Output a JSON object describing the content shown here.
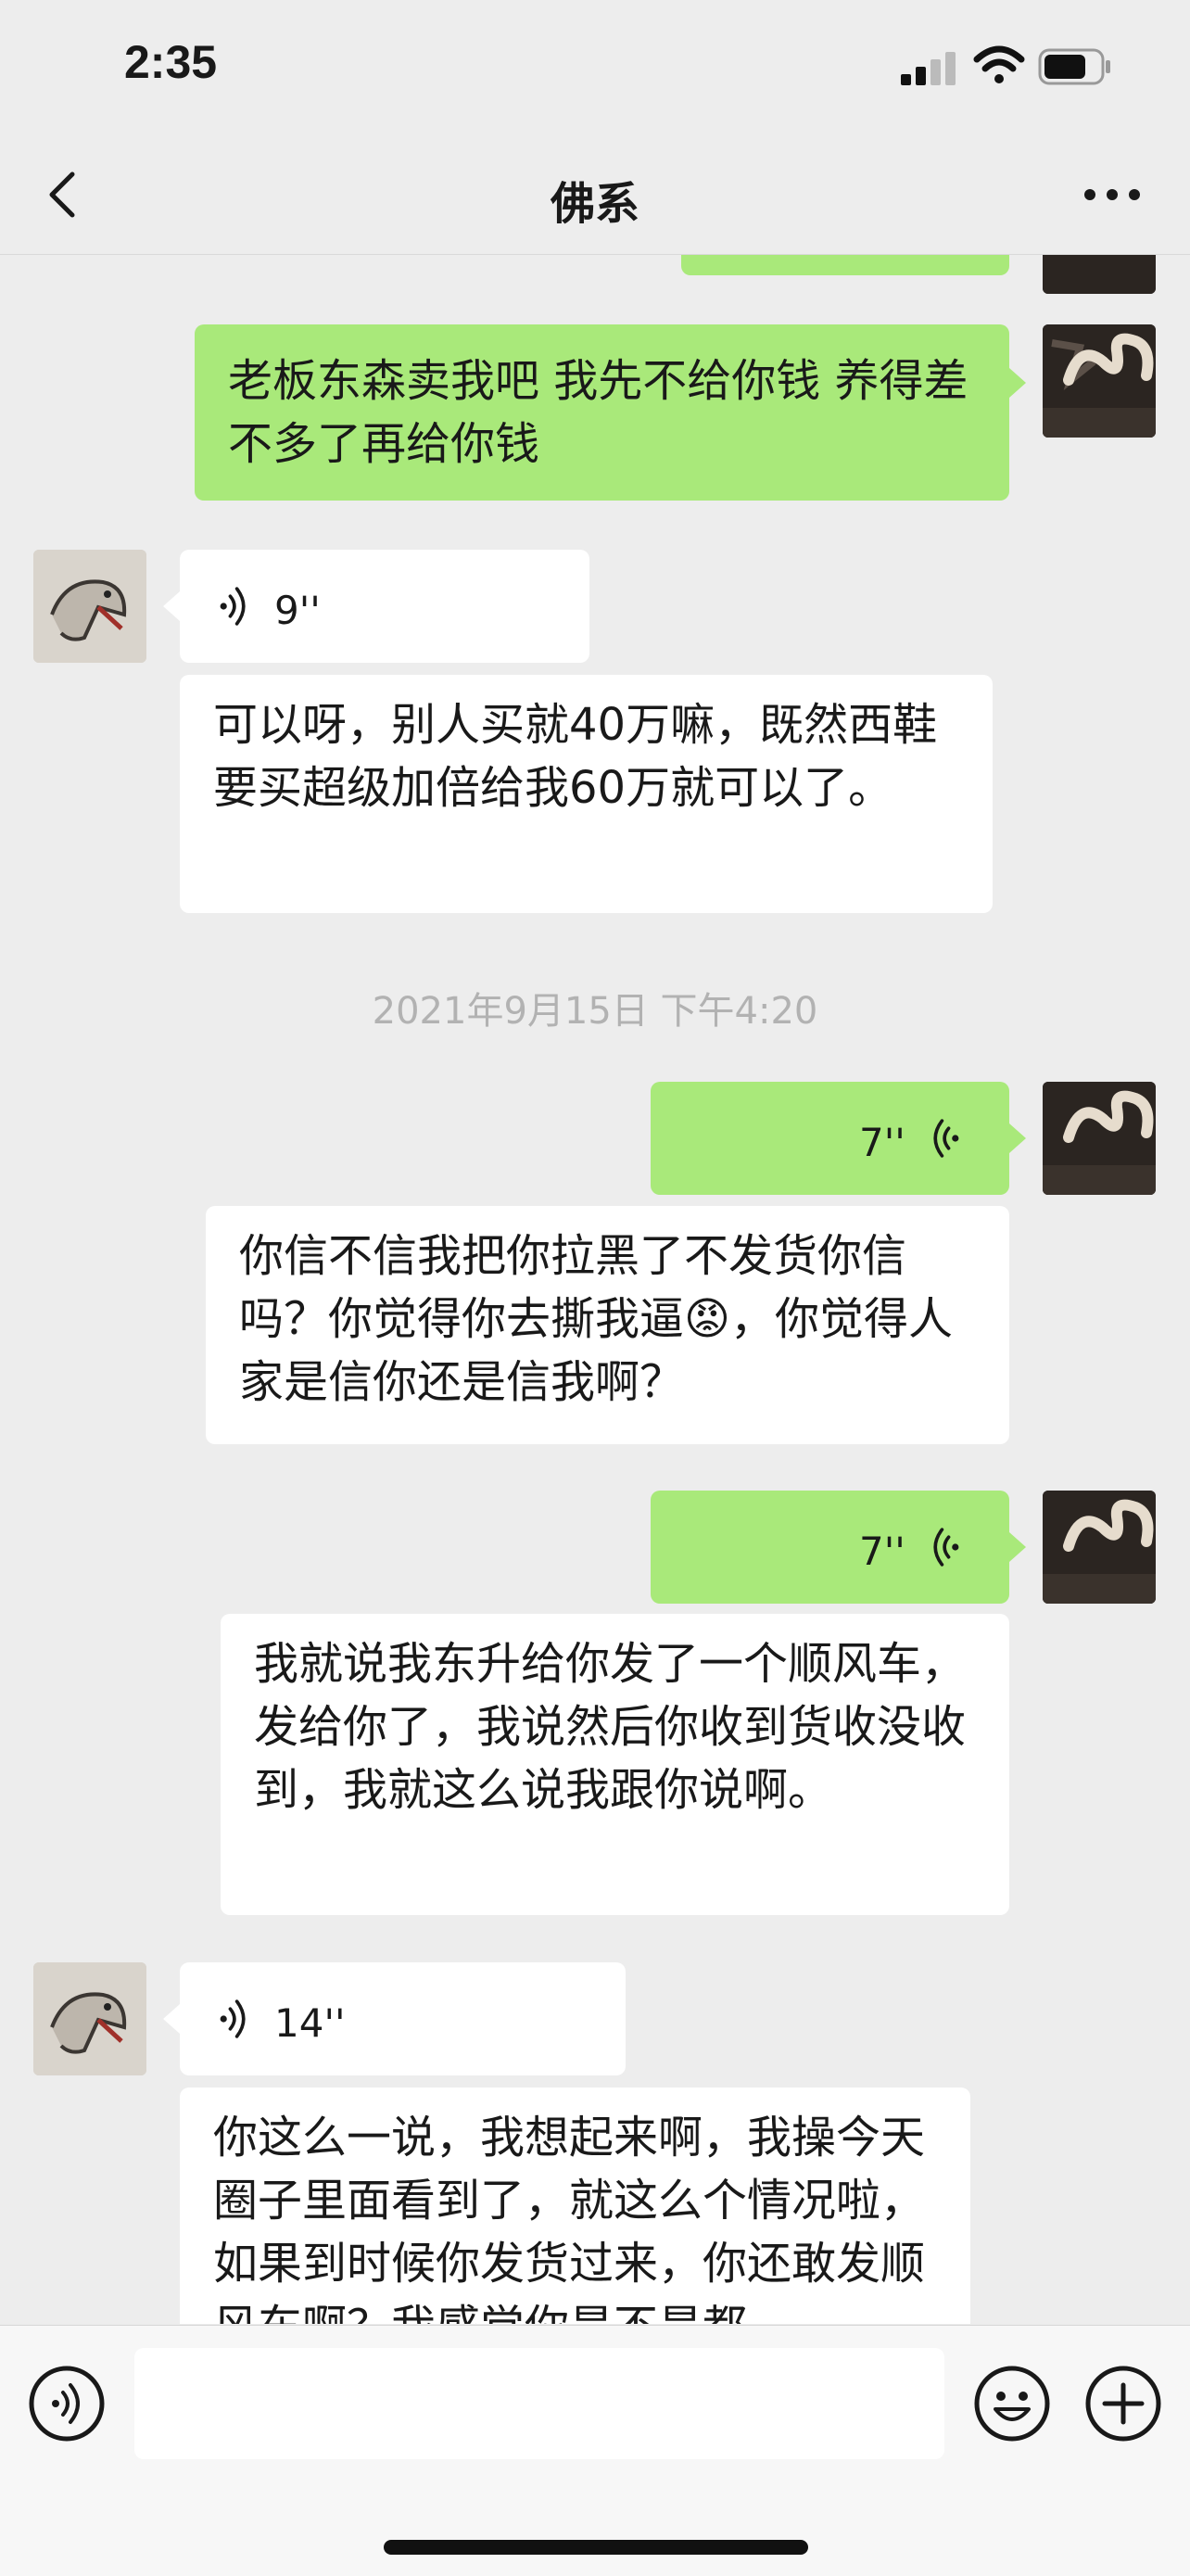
{
  "status_bar": {
    "time": "2:35"
  },
  "header": {
    "title": "佛系"
  },
  "messages": {
    "m1": {
      "text": "老板东森卖我吧 我先不给你钱 养得差不多了再给你钱"
    },
    "m2": {
      "duration": "9''"
    },
    "m3": {
      "text": "可以呀，别人买就40万嘛，既然西鞋要买超级加倍给我60万就可以了。"
    },
    "timestamp": "2021年9月15日 下午4:20",
    "m4": {
      "duration": "7''"
    },
    "m5": {
      "text": "你信不信我把你拉黑了不发货你信吗？你觉得你去撕我逼😡，你觉得人家是信你还是信我啊？"
    },
    "m6": {
      "duration": "7''"
    },
    "m7": {
      "text": "我就说我东升给你发了一个顺风车，发给你了，我说然后你收到货收没收到，我就这么说我跟你说啊。"
    },
    "m8": {
      "duration": "14''"
    },
    "m9": {
      "text": "你这么一说，我想起来啊，我操今天圈子里面看到了，就这么个情况啦，如果到时候你发货过来，你还敢发顺风车啊？我感觉你是不是都"
    }
  },
  "colors": {
    "sent_bubble": "#a9e97a",
    "received_bubble": "#ffffff",
    "background": "#ededed"
  },
  "icons": [
    "back-arrow-icon",
    "more-dots-icon",
    "voice-wave-icon",
    "emoji-face-icon",
    "plus-circle-icon",
    "signal-icon",
    "wifi-icon",
    "battery-icon"
  ]
}
